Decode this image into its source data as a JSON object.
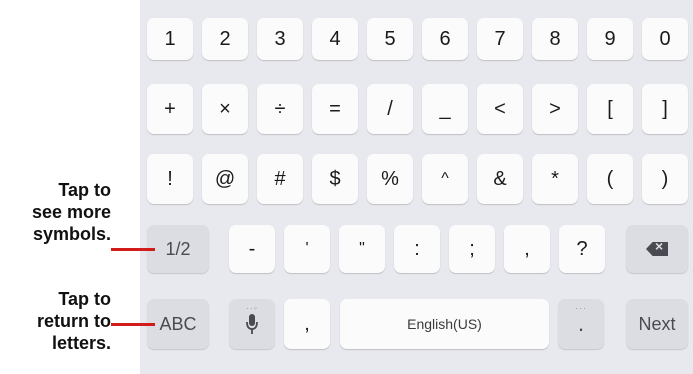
{
  "keyboard": {
    "row1": [
      "1",
      "2",
      "3",
      "4",
      "5",
      "6",
      "7",
      "8",
      "9",
      "0"
    ],
    "row2": [
      "+",
      "×",
      "÷",
      "=",
      "/",
      "_",
      "<",
      ">",
      "[",
      "]"
    ],
    "row3": [
      "!",
      "@",
      "#",
      "$",
      "%",
      "^",
      "&",
      "*",
      "(",
      ")"
    ],
    "row4": {
      "page_toggle": "1/2",
      "keys": [
        "-",
        "'",
        "\"",
        ":",
        ";",
        ",",
        "?"
      ],
      "backspace_icon": "backspace-icon"
    },
    "row5": {
      "abc": "ABC",
      "mic_icon": "microphone-icon",
      "comma": ",",
      "space": "English(US)",
      "period": ".",
      "next": "Next"
    }
  },
  "annotations": {
    "symbols": [
      "Tap to",
      "see more",
      "symbols."
    ],
    "letters": [
      "Tap to",
      "return to",
      "letters."
    ]
  },
  "colors": {
    "keyboard_bg": "#e8e9ee",
    "key_bg": "#fbfbfc",
    "function_key_bg": "#dcdde3",
    "leader_line": "#d21c1c"
  }
}
